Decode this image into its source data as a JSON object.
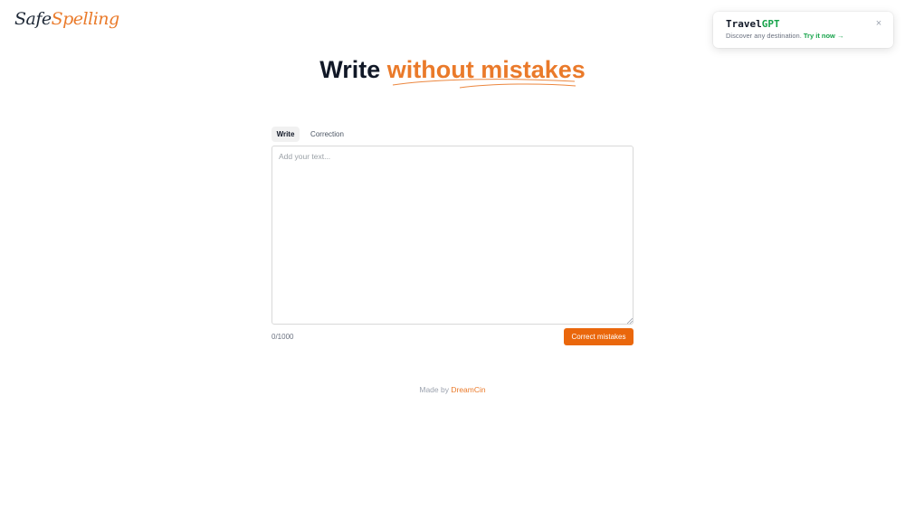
{
  "logo": {
    "part_a": "Safe",
    "part_b": "Spelling"
  },
  "toast": {
    "title_a": "Travel",
    "title_b": "GPT",
    "description": "Discover any destination.",
    "link_label": "Try it now →",
    "close_glyph": "×"
  },
  "hero": {
    "title_a": "Write ",
    "title_b": "without mistakes"
  },
  "tabs": [
    {
      "label": "Write",
      "active": true
    },
    {
      "label": "Correction",
      "active": false
    }
  ],
  "editor": {
    "placeholder": "Add your text...",
    "value": ""
  },
  "counter": "0/1000",
  "correct_button": "Correct mistakes",
  "footer": {
    "prefix": "Made by ",
    "link": "DreamCin"
  },
  "colors": {
    "accent": "#ea7a2a",
    "button": "#ea670c",
    "promo_accent": "#16a34a",
    "text_dark": "#111827"
  }
}
